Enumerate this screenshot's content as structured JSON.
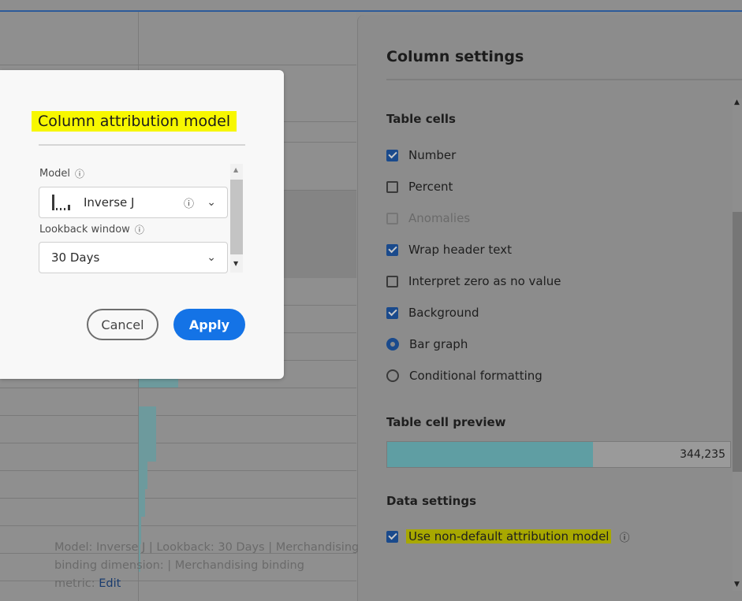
{
  "modal": {
    "title": "Column attribution model",
    "model_label": "Model",
    "model_value": "Inverse J",
    "lookback_label": "Lookback window",
    "lookback_value": "30 Days",
    "cancel_label": "Cancel",
    "apply_label": "Apply",
    "help_icon": "ⓘ",
    "apply_color": "#1473e6",
    "highlight_color": "#f7f700"
  },
  "panel": {
    "title": "Column settings",
    "table_cells": {
      "heading": "Table cells",
      "options": [
        {
          "label": "Number",
          "control": "checkbox",
          "checked": true,
          "disabled": false
        },
        {
          "label": "Percent",
          "control": "checkbox",
          "checked": false,
          "disabled": false
        },
        {
          "label": "Anomalies",
          "control": "checkbox",
          "checked": false,
          "disabled": true
        },
        {
          "label": "Wrap header text",
          "control": "checkbox",
          "checked": true,
          "disabled": false
        },
        {
          "label": "Interpret zero as no value",
          "control": "checkbox",
          "checked": false,
          "disabled": false
        },
        {
          "label": "Background",
          "control": "checkbox",
          "checked": true,
          "disabled": false
        },
        {
          "label": "Bar graph",
          "control": "radio",
          "checked": true,
          "disabled": false
        },
        {
          "label": "Conditional formatting",
          "control": "radio",
          "checked": false,
          "disabled": false
        }
      ]
    },
    "preview": {
      "heading": "Table cell preview",
      "value": "344,235",
      "fill_fraction": 0.6
    },
    "data_settings": {
      "heading": "Data settings",
      "checkbox_label": "Use non-default attribution model",
      "checked": true,
      "description": "Model: Inverse J | Lookback: 30 Days | Merchandising binding dimension: | Merchandising binding metric:",
      "edit_label": "Edit"
    }
  },
  "background_table": {
    "bar_values": [
      0.18,
      0.08,
      0.08,
      0.04,
      0.03,
      0.01,
      0.005
    ]
  }
}
